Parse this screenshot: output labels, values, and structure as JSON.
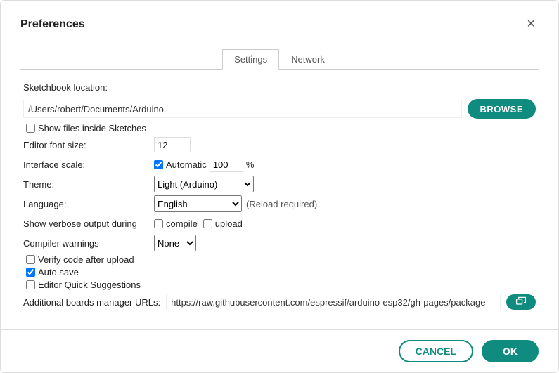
{
  "title": "Preferences",
  "tabs": {
    "settings": "Settings",
    "network": "Network"
  },
  "sketchbook": {
    "label": "Sketchbook location:",
    "value": "/Users/robert/Documents/Arduino",
    "browse": "BROWSE",
    "showFilesLabel": "Show files inside Sketches",
    "showFilesChecked": false
  },
  "font": {
    "label": "Editor font size:",
    "value": "12"
  },
  "scale": {
    "label": "Interface scale:",
    "autoLabel": "Automatic",
    "autoChecked": true,
    "value": "100",
    "suffix": "%"
  },
  "theme": {
    "label": "Theme:",
    "value": "Light (Arduino)"
  },
  "language": {
    "label": "Language:",
    "value": "English",
    "note": "(Reload required)"
  },
  "verbose": {
    "label": "Show verbose output during",
    "compileLabel": "compile",
    "compileChecked": false,
    "uploadLabel": "upload",
    "uploadChecked": false
  },
  "warnings": {
    "label": "Compiler warnings",
    "value": "None"
  },
  "opts": {
    "verifyLabel": "Verify code after upload",
    "verifyChecked": false,
    "autosaveLabel": "Auto save",
    "autosaveChecked": true,
    "quickLabel": "Editor Quick Suggestions",
    "quickChecked": false
  },
  "urls": {
    "label": "Additional boards manager URLs:",
    "value": "https://raw.githubusercontent.com/espressif/arduino-esp32/gh-pages/package"
  },
  "footer": {
    "cancel": "CANCEL",
    "ok": "OK"
  }
}
